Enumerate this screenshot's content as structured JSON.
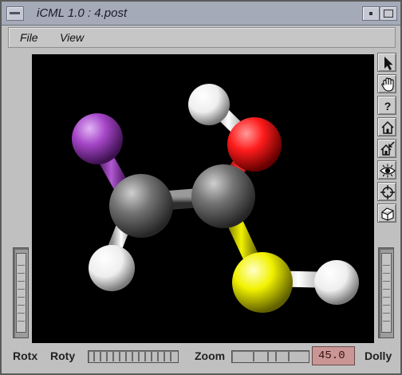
{
  "window": {
    "title": "iCML 1.0 : 4.post"
  },
  "menubar": {
    "items": [
      {
        "label": "File"
      },
      {
        "label": "View"
      }
    ]
  },
  "toolbar": {
    "tools": [
      {
        "name": "pointer-tool",
        "icon": "arrow-cursor-icon"
      },
      {
        "name": "hand-tool",
        "icon": "hand-icon"
      },
      {
        "name": "help-tool",
        "icon": "question-mark-icon"
      },
      {
        "name": "home-tool",
        "icon": "home-icon"
      },
      {
        "name": "set-home-tool",
        "icon": "home-with-arrow-icon"
      },
      {
        "name": "view-all-tool",
        "icon": "eye-icon"
      },
      {
        "name": "seek-tool",
        "icon": "crosshair-icon"
      },
      {
        "name": "projection-tool",
        "icon": "perspective-cube-icon"
      }
    ]
  },
  "molecule": {
    "atoms": [
      {
        "element": "I",
        "color": "#a646c8"
      },
      {
        "element": "C",
        "color": "#737373"
      },
      {
        "element": "C",
        "color": "#737373"
      },
      {
        "element": "O",
        "color": "#ff1c1c"
      },
      {
        "element": "S",
        "color": "#f2f200"
      },
      {
        "element": "H",
        "color": "#ffffff"
      },
      {
        "element": "H",
        "color": "#ffffff"
      },
      {
        "element": "H",
        "color": "#ffffff"
      }
    ]
  },
  "controls": {
    "rotx_label": "Rotx",
    "roty_label": "Roty",
    "zoom_label": "Zoom",
    "zoom_value": "45.0",
    "dolly_label": "Dolly"
  }
}
